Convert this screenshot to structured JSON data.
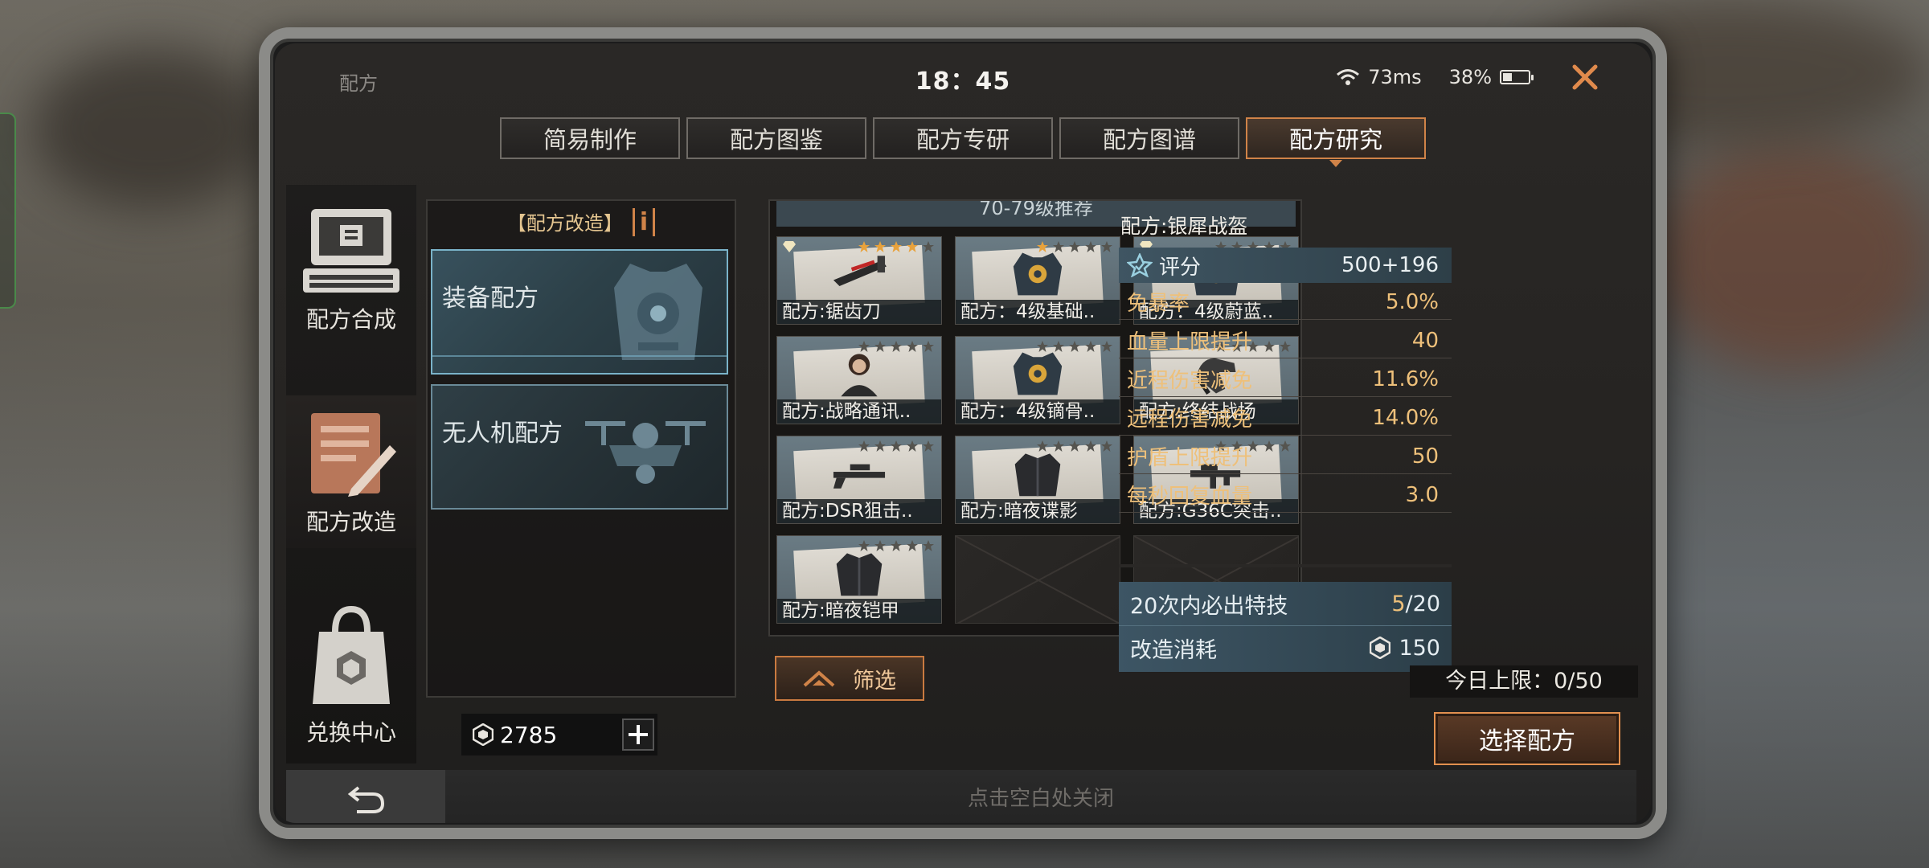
{
  "status_bar": {
    "title": "配方",
    "time": "18：45",
    "ping": "73ms",
    "battery": "38%",
    "battery_level": 0.38
  },
  "tabs": [
    {
      "label": "简易制作",
      "active": false
    },
    {
      "label": "配方图鉴",
      "active": false
    },
    {
      "label": "配方专研",
      "active": false
    },
    {
      "label": "配方图谱",
      "active": false
    },
    {
      "label": "配方研究",
      "active": true
    }
  ],
  "left_nav": [
    {
      "label": "配方合成",
      "icon": "terminal-icon"
    },
    {
      "label": "配方改造",
      "icon": "recipe-edit-icon"
    },
    {
      "label": "兑换中心",
      "icon": "shop-bag-icon"
    }
  ],
  "recipe_section": {
    "header": "【配方改造】",
    "info_icon": "i",
    "cards": [
      {
        "label": "装备配方",
        "icon": "armor-vest-icon",
        "selected": true
      },
      {
        "label": "无人机配方",
        "icon": "drone-icon",
        "selected": false
      }
    ]
  },
  "currency": {
    "amount": "2785",
    "icon": "cube-coin-icon"
  },
  "grid": {
    "title": "70-79级推荐",
    "items": [
      {
        "label": "配方:锯齿刀",
        "item_icon": "saw-blade-icon",
        "stars": 4,
        "diamond": true
      },
      {
        "label": "配方：4级基础..",
        "item_icon": "armor-icon",
        "stars": 1,
        "diamond": false
      },
      {
        "label": "配方：4级蔚蓝..",
        "item_icon": "armor-icon",
        "stars": 0,
        "diamond": true
      },
      {
        "label": "配方:战略通讯..",
        "item_icon": "character-icon",
        "stars": 0,
        "diamond": false
      },
      {
        "label": "配方：4级镝骨..",
        "item_icon": "armor-icon",
        "stars": 0,
        "diamond": false
      },
      {
        "label": "配方:终结战场",
        "item_icon": "glove-icon",
        "stars": 0,
        "diamond": false
      },
      {
        "label": "配方:DSR狙击..",
        "item_icon": "sniper-rifle-icon",
        "stars": 0,
        "diamond": false
      },
      {
        "label": "配方:暗夜谍影",
        "item_icon": "suit-icon",
        "stars": 0,
        "diamond": false
      },
      {
        "label": "配方:G36C突击..",
        "item_icon": "assault-rifle-icon",
        "stars": 0,
        "diamond": false
      },
      {
        "label": "配方:暗夜铠甲",
        "item_icon": "suit-icon",
        "stars": 0,
        "diamond": false
      }
    ]
  },
  "filter_button": "筛选",
  "stats": {
    "title": "配方:银犀战盔",
    "score_label": "评分",
    "score_value": "500+196",
    "rows": [
      {
        "key": "免暴率",
        "value": "5.0%"
      },
      {
        "key": "血量上限提升",
        "value": "40"
      },
      {
        "key": "近程伤害减免",
        "value": "11.6%"
      },
      {
        "key": "远程伤害减免",
        "value": "14.0%"
      },
      {
        "key": "护盾上限提升",
        "value": "50"
      },
      {
        "key": "每秒回复血量",
        "value": "3.0"
      }
    ],
    "special_label": "20次内必出特技",
    "special_current": "5",
    "special_total": "/20",
    "cost_label": "改造消耗",
    "cost_value": "150"
  },
  "daily_limit": "今日上限：0/50",
  "select_button": "选择配方",
  "bottom_hint": "点击空白处关闭",
  "colors": {
    "accent": "#d08348",
    "gold_text": "#eec07a",
    "panel_blue": "#3d5564"
  }
}
